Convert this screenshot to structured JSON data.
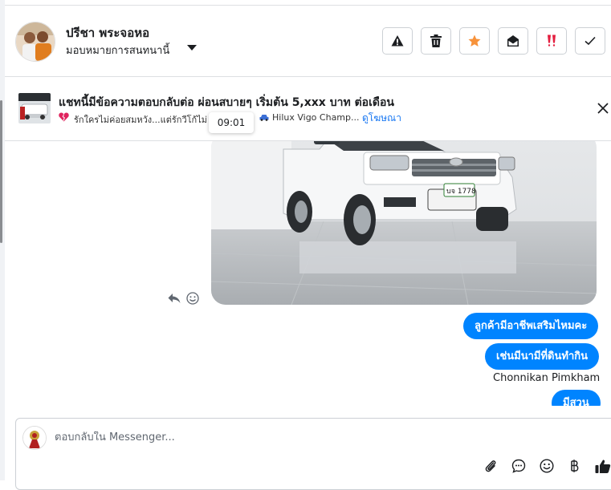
{
  "header": {
    "contact_name": "ปรีชา พระจอหอ",
    "assign_label": "มอบหมายการสนทนานี้",
    "actions": {
      "report": "warning-icon",
      "delete": "trash-icon",
      "star": "star-icon",
      "mark_unread": "envelope-open-icon",
      "important": "double-exclamation-icon",
      "done": "check-icon"
    },
    "star_color": "#f7923a",
    "important_color": "#e41e3f"
  },
  "ad": {
    "title": "แชทนี้มีข้อความตอบกลับต่อ ผ่อนสบายๆ เริ่มต้น 5,xxx บาท ต่อเดือน",
    "subtitle_left": "รักใครไม่ค่อยสมหวัง...แต่รักวีโก้ไม่",
    "subtitle_right": "Hilux Vigo Champ...",
    "link_label": "ดูโฆษณา",
    "tooltip_time": "09:01"
  },
  "messages": {
    "outgoing": [
      "ลูกค้ามีอาชีพเสริมไหมคะ",
      "เช่นมีนามีที่ดินทำกิน",
      "มีสวน"
    ],
    "sender_name": "Chonnikan Pimkham",
    "car_plate": "บจ 1778"
  },
  "composer": {
    "placeholder": "ตอบกลับใน Messenger...",
    "tools": [
      "paperclip-icon",
      "chat-icon",
      "emoji-icon",
      "baht-icon",
      "thumbs-up-icon"
    ]
  },
  "colors": {
    "accent": "#0084ff",
    "link": "#1877f2",
    "border": "#ccd0d5"
  }
}
